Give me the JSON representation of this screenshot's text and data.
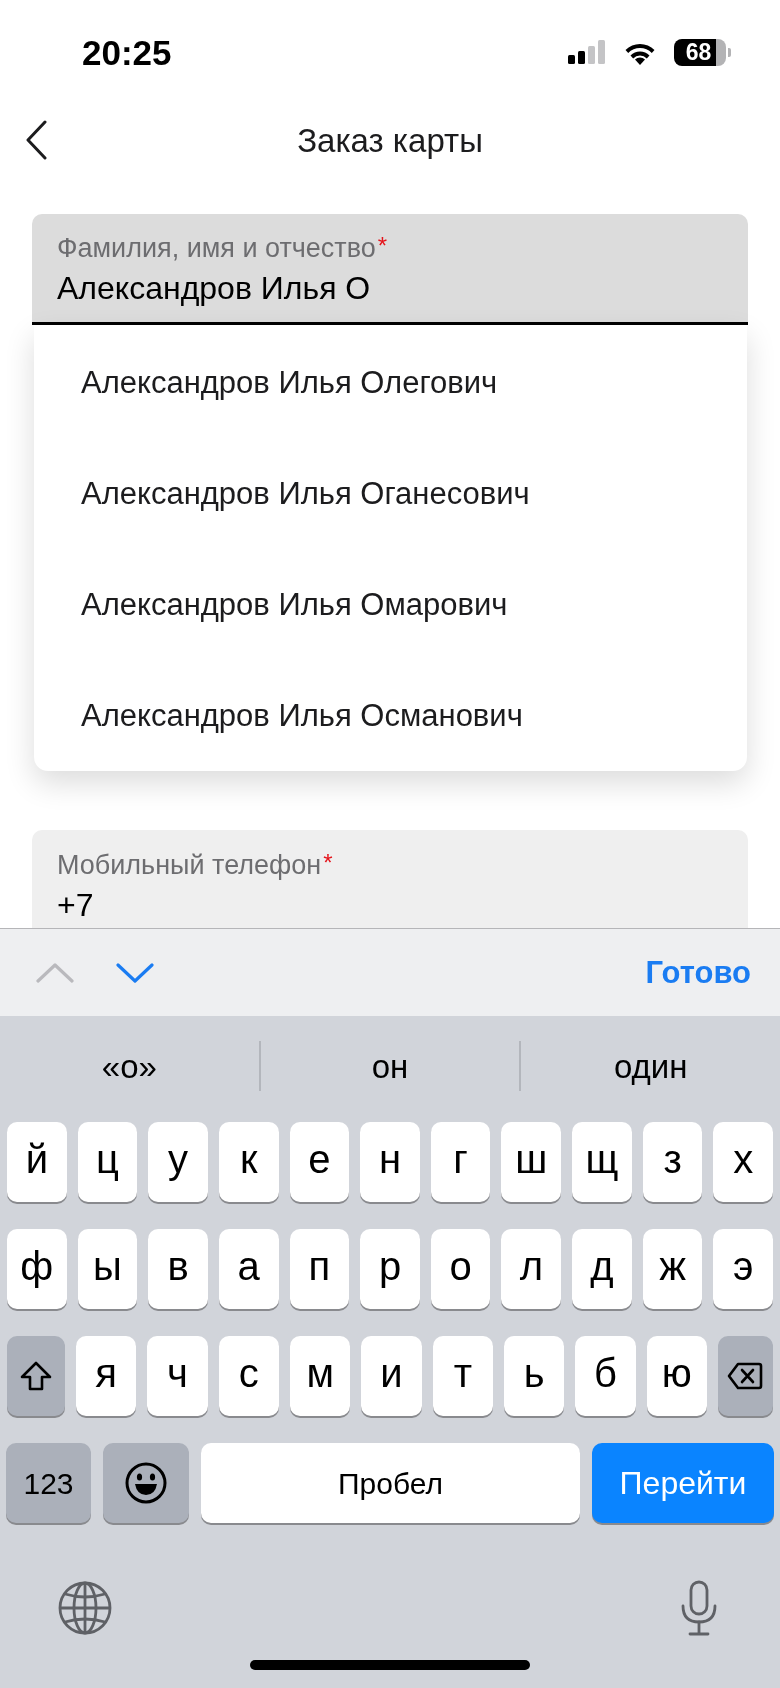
{
  "status_bar": {
    "time": "20:25",
    "battery": "68"
  },
  "header": {
    "title": "Заказ карты"
  },
  "form": {
    "fields": [
      {
        "label": "Фамилия, имя и отчество",
        "required_mark": "*",
        "value": "Александров Илья О",
        "focused": true
      },
      {
        "label": "Мобильный телефон",
        "required_mark": "*",
        "value": "+7",
        "focused": false
      }
    ]
  },
  "suggestions": [
    {
      "text": "Александров Илья Олегович"
    },
    {
      "text": "Александров Илья Оганесович"
    },
    {
      "text": "Александров Илья Омарович"
    },
    {
      "text": "Александров Илья Османович"
    }
  ],
  "keyboard_toolbar": {
    "arrows": [
      {
        "kind": "previous",
        "disabled": true
      },
      {
        "kind": "next",
        "disabled": false
      }
    ],
    "done": "Готово"
  },
  "keyboard": {
    "predictions": [
      "«о»",
      "он",
      "один"
    ],
    "letter_rows": [
      [
        {
          "kind": "letter",
          "label": "й"
        },
        {
          "kind": "letter",
          "label": "ц"
        },
        {
          "kind": "letter",
          "label": "у"
        },
        {
          "kind": "letter",
          "label": "к"
        },
        {
          "kind": "letter",
          "label": "е"
        },
        {
          "kind": "letter",
          "label": "н"
        },
        {
          "kind": "letter",
          "label": "г"
        },
        {
          "kind": "letter",
          "label": "ш"
        },
        {
          "kind": "letter",
          "label": "щ"
        },
        {
          "kind": "letter",
          "label": "з"
        },
        {
          "kind": "letter",
          "label": "х"
        }
      ],
      [
        {
          "kind": "letter",
          "label": "ф"
        },
        {
          "kind": "letter",
          "label": "ы"
        },
        {
          "kind": "letter",
          "label": "в"
        },
        {
          "kind": "letter",
          "label": "а"
        },
        {
          "kind": "letter",
          "label": "п"
        },
        {
          "kind": "letter",
          "label": "р"
        },
        {
          "kind": "letter",
          "label": "о"
        },
        {
          "kind": "letter",
          "label": "л"
        },
        {
          "kind": "letter",
          "label": "д"
        },
        {
          "kind": "letter",
          "label": "ж"
        },
        {
          "kind": "letter",
          "label": "э"
        }
      ],
      [
        {
          "kind": "shift"
        },
        {
          "kind": "letter",
          "label": "я"
        },
        {
          "kind": "letter",
          "label": "ч"
        },
        {
          "kind": "letter",
          "label": "с"
        },
        {
          "kind": "letter",
          "label": "м"
        },
        {
          "kind": "letter",
          "label": "и"
        },
        {
          "kind": "letter",
          "label": "т"
        },
        {
          "kind": "letter",
          "label": "ь"
        },
        {
          "kind": "letter",
          "label": "б"
        },
        {
          "kind": "letter",
          "label": "ю"
        },
        {
          "kind": "backspace"
        }
      ]
    ],
    "function_row": [
      {
        "kind": "numbers",
        "label": "123"
      },
      {
        "kind": "emoji"
      },
      {
        "kind": "space",
        "label": "Пробел"
      },
      {
        "kind": "go",
        "label": "Перейти"
      }
    ]
  }
}
